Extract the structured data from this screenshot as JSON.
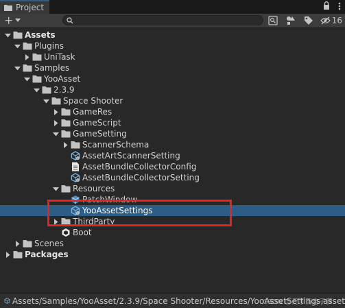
{
  "tab": {
    "title": "Project"
  },
  "toolbar": {
    "add_label": "+",
    "search": {
      "value": "",
      "placeholder": ""
    },
    "hidden_count": "16"
  },
  "tree": [
    {
      "label": "Assets",
      "depth": 0,
      "expanded": true,
      "type": "folder",
      "bold": true
    },
    {
      "label": "Plugins",
      "depth": 1,
      "expanded": true,
      "type": "folder"
    },
    {
      "label": "UniTask",
      "depth": 2,
      "expanded": false,
      "type": "folder"
    },
    {
      "label": "Samples",
      "depth": 1,
      "expanded": true,
      "type": "folder"
    },
    {
      "label": "YooAsset",
      "depth": 2,
      "expanded": true,
      "type": "folder"
    },
    {
      "label": "2.3.9",
      "depth": 3,
      "expanded": true,
      "type": "folder"
    },
    {
      "label": "Space Shooter",
      "depth": 4,
      "expanded": true,
      "type": "folder"
    },
    {
      "label": "GameRes",
      "depth": 5,
      "expanded": false,
      "type": "folder"
    },
    {
      "label": "GameScript",
      "depth": 5,
      "expanded": false,
      "type": "folder"
    },
    {
      "label": "GameSetting",
      "depth": 5,
      "expanded": true,
      "type": "folder"
    },
    {
      "label": "ScannerSchema",
      "depth": 6,
      "expanded": false,
      "type": "folder"
    },
    {
      "label": "AssetArtScannerSetting",
      "depth": 6,
      "type": "scriptable"
    },
    {
      "label": "AssetBundleCollectorConfig",
      "depth": 6,
      "type": "file"
    },
    {
      "label": "AssetBundleCollectorSetting",
      "depth": 6,
      "type": "scriptable"
    },
    {
      "label": "Resources",
      "depth": 5,
      "expanded": true,
      "type": "folder"
    },
    {
      "label": "PatchWindow",
      "depth": 6,
      "type": "prefab"
    },
    {
      "label": "YooAssetSettings",
      "depth": 6,
      "type": "scriptable",
      "selected": true
    },
    {
      "label": "ThirdParty",
      "depth": 5,
      "expanded": false,
      "type": "folder"
    },
    {
      "label": "Boot",
      "depth": 5,
      "type": "scene"
    },
    {
      "label": "Scenes",
      "depth": 1,
      "expanded": false,
      "type": "folder"
    },
    {
      "label": "Packages",
      "depth": 0,
      "expanded": false,
      "type": "folder",
      "bold": true
    }
  ],
  "status": {
    "path": "Assets/Samples/YooAsset/2.3.9/Space Shooter/Resources/YooAssetSettings.asset",
    "watermark": "CSDN @元宇宙电子萝"
  },
  "colors": {
    "background": "#282828",
    "selection": "#2c5d87",
    "highlight_box": "#e32424",
    "folder": "#c2c2c2"
  }
}
